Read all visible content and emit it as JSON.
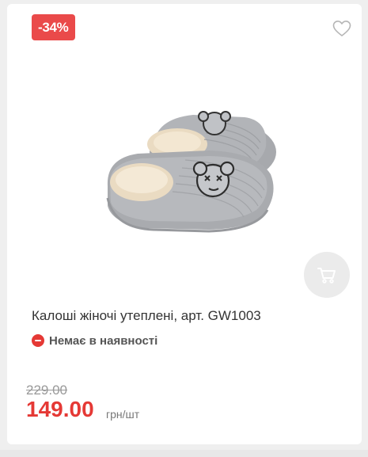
{
  "product": {
    "discount_badge": "-34%",
    "title": "Калоші жіночі утеплені, арт. GW1003",
    "stock_status": "Немає в наявності",
    "old_price": "229.00",
    "price": "149.00",
    "unit": "грн/шт"
  },
  "icons": {
    "favorite": "heart-outline-icon",
    "cart": "cart-icon",
    "stock": "minus-circle-icon"
  },
  "colors": {
    "accent": "#e53935",
    "badge": "#ea4a4a",
    "cart_button_bg": "#ebebeb"
  }
}
